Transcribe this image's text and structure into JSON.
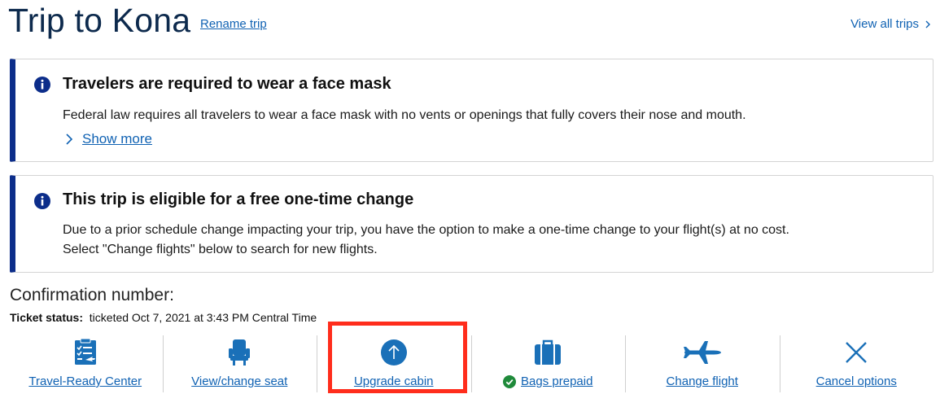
{
  "header": {
    "title": "Trip to Kona",
    "rename_link": "Rename trip",
    "view_all_link": "View all trips"
  },
  "alerts": [
    {
      "title": "Travelers are required to wear a face mask",
      "body": "Federal law requires all travelers to wear a face mask with no vents or openings that fully covers their nose and mouth.",
      "show_more": "Show more"
    },
    {
      "title": "This trip is eligible for a free one-time change",
      "body_line1": "Due to a prior schedule change impacting your trip, you have the option to make a one-time change to your flight(s) at no cost.",
      "body_line2": "Select \"Change flights\" below to search for new flights."
    }
  ],
  "confirmation": {
    "label": "Confirmation number:",
    "ticket_status_label": "Ticket status:",
    "ticket_status_value": "ticketed Oct 7, 2021 at 3:43 PM Central Time"
  },
  "actions": [
    {
      "label": "Travel-Ready Center",
      "icon": "checklist-icon"
    },
    {
      "label": "View/change seat",
      "icon": "seat-icon"
    },
    {
      "label": "Upgrade cabin",
      "icon": "upgrade-arrow-icon"
    },
    {
      "label": "Bags prepaid",
      "icon": "suitcase-icon",
      "status_icon": "check-circle-icon"
    },
    {
      "label": "Change flight",
      "icon": "airplane-icon"
    },
    {
      "label": "Cancel options",
      "icon": "close-icon"
    }
  ],
  "colors": {
    "link": "#1062b3",
    "alert_accent": "#0c2d8a",
    "icon_blue": "#1a70b8",
    "highlight": "#ff2d1c",
    "success": "#1f8a3a"
  }
}
